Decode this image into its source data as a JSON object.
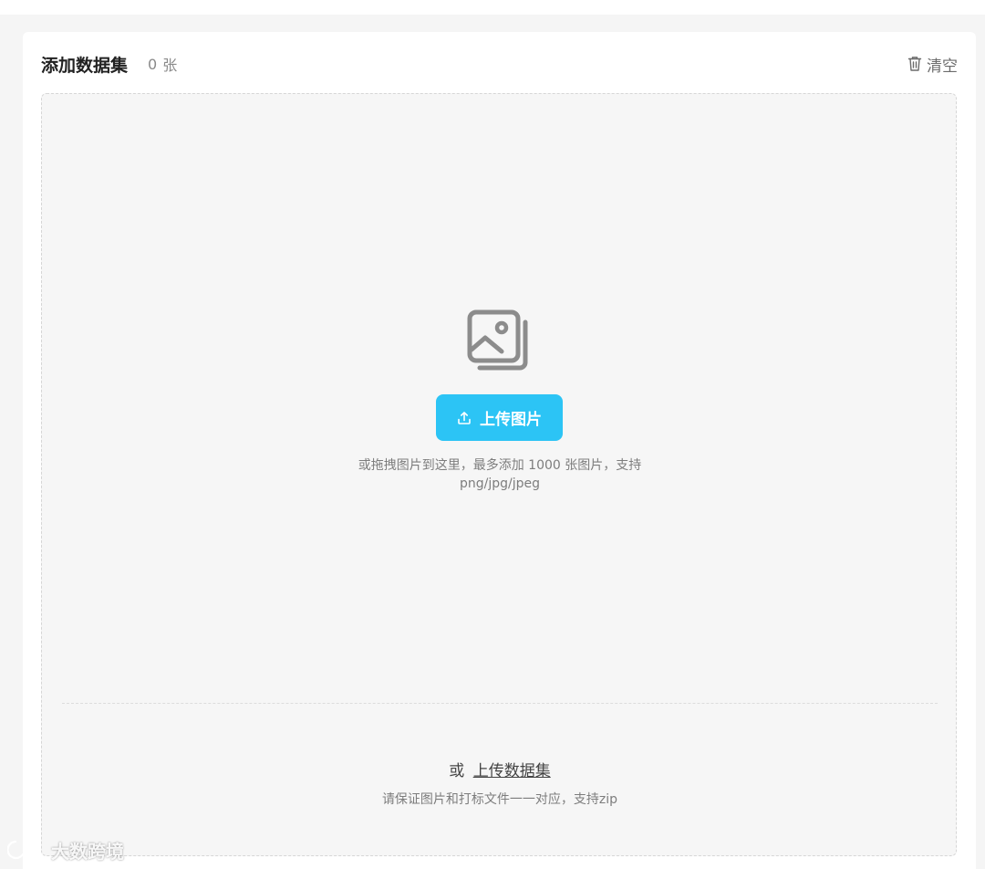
{
  "header": {
    "title": "添加数据集",
    "count_value": "0",
    "count_unit": "张",
    "clear_label": "清空"
  },
  "dropzone": {
    "upload_button_label": "上传图片",
    "hint_line1": "或拖拽图片到这里，最多添加 1000 张图片，支持",
    "hint_line2": "png/jpg/jpeg"
  },
  "alternative": {
    "prefix": "或",
    "link_label": "上传数据集",
    "hint": "请保证图片和打标文件一一对应，支持zip"
  },
  "watermark": {
    "text": "大数跨境"
  },
  "colors": {
    "accent": "#2cc4f5",
    "background": "#f5f5f5",
    "dropzone_bg": "#f6f6f6"
  },
  "icons": {
    "clear": "trash-icon",
    "empty_state": "image-stack-icon",
    "upload": "upload-icon",
    "watermark": "logo-icon"
  }
}
